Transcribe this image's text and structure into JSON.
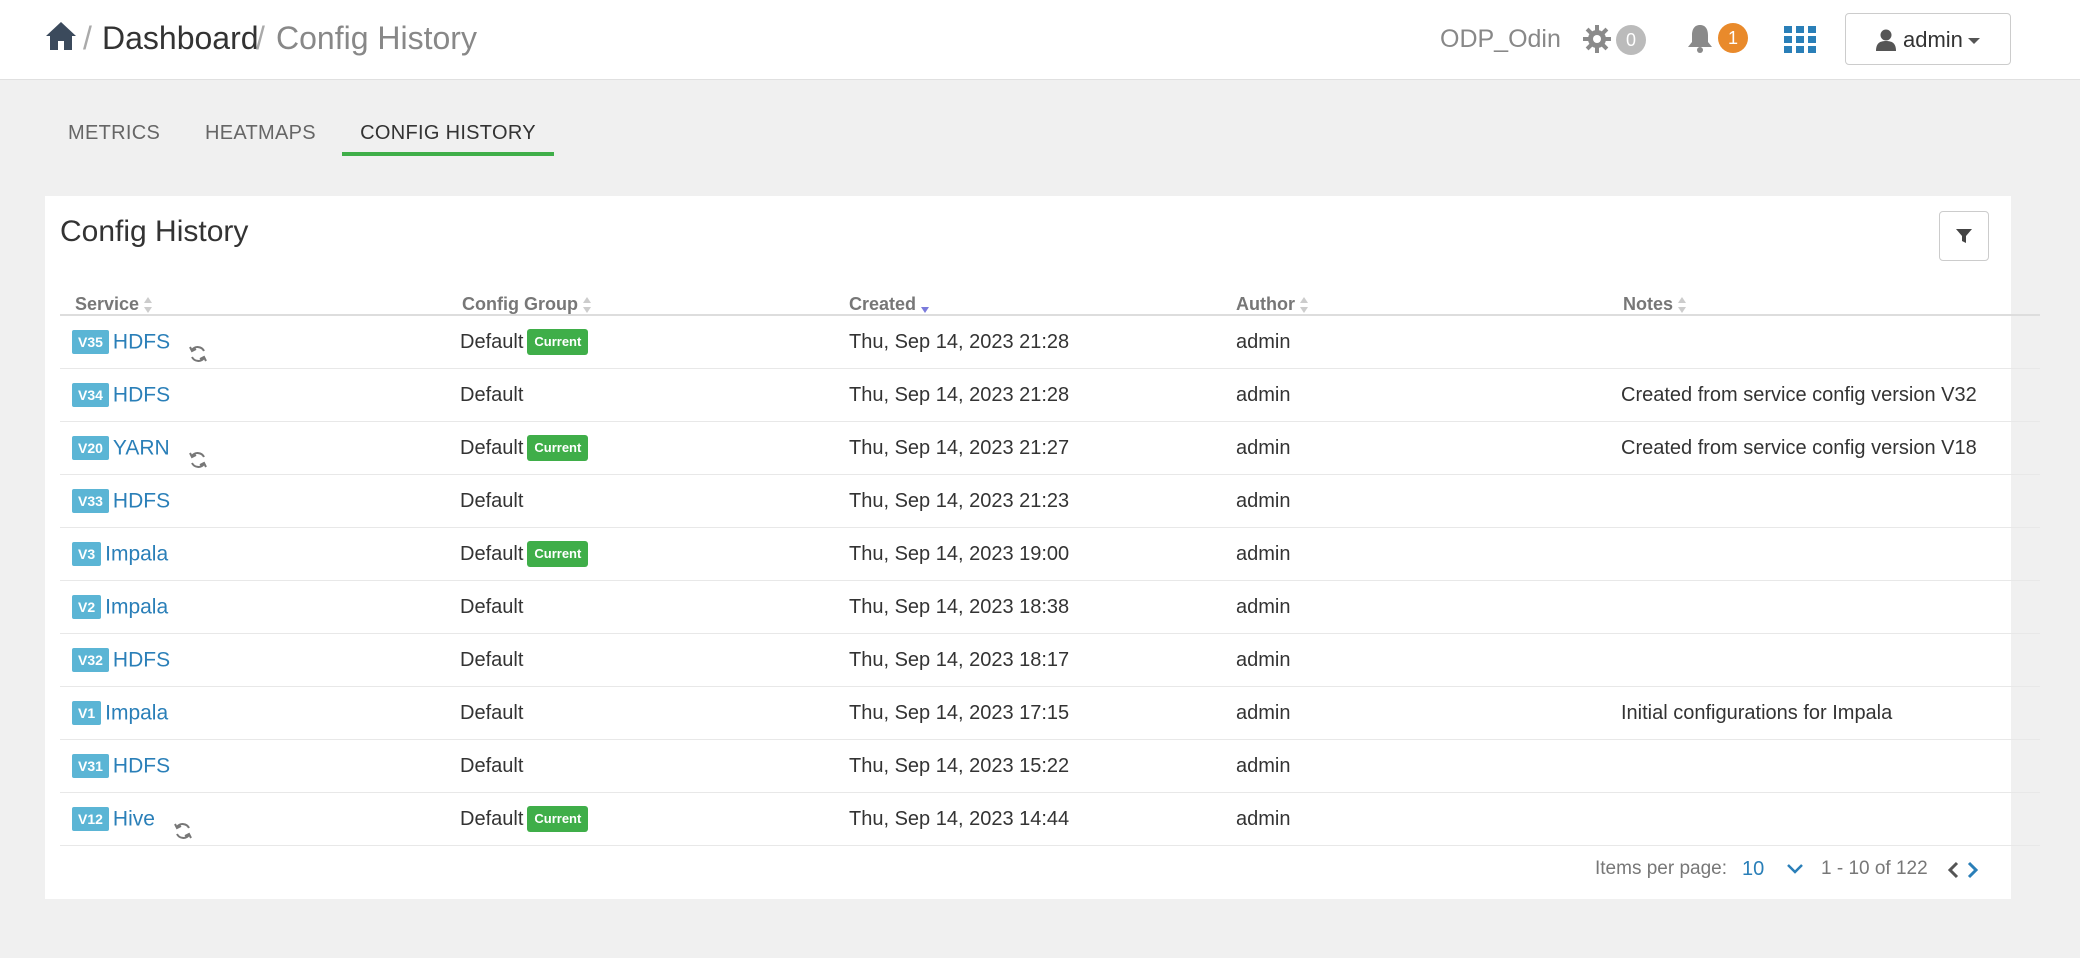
{
  "header": {
    "breadcrumb": {
      "sep1": "/",
      "dashboard": "Dashboard",
      "sep2": "/",
      "current": "Config History"
    },
    "cluster_name": "ODP_Odin",
    "ops_count": "0",
    "alerts_count": "1",
    "user_label": "admin"
  },
  "tabs": [
    {
      "label": "METRICS"
    },
    {
      "label": "HEATMAPS"
    },
    {
      "label": "CONFIG HISTORY"
    }
  ],
  "panel": {
    "title": "Config History",
    "columns": [
      "Service",
      "Config Group",
      "Created",
      "Author",
      "Notes"
    ]
  },
  "rows": [
    {
      "version": "V35",
      "service": "HDFS",
      "refresh": true,
      "group": "Default",
      "current": "Current",
      "created": "Thu, Sep 14, 2023 21:28",
      "author": "admin",
      "notes": ""
    },
    {
      "version": "V34",
      "service": "HDFS",
      "refresh": false,
      "group": "Default",
      "current": "",
      "created": "Thu, Sep 14, 2023 21:28",
      "author": "admin",
      "notes": "Created from service config version V32"
    },
    {
      "version": "V20",
      "service": "YARN",
      "refresh": true,
      "group": "Default",
      "current": "Current",
      "created": "Thu, Sep 14, 2023 21:27",
      "author": "admin",
      "notes": "Created from service config version V18"
    },
    {
      "version": "V33",
      "service": "HDFS",
      "refresh": false,
      "group": "Default",
      "current": "",
      "created": "Thu, Sep 14, 2023 21:23",
      "author": "admin",
      "notes": ""
    },
    {
      "version": "V3",
      "service": "Impala",
      "refresh": false,
      "group": "Default",
      "current": "Current",
      "created": "Thu, Sep 14, 2023 19:00",
      "author": "admin",
      "notes": ""
    },
    {
      "version": "V2",
      "service": "Impala",
      "refresh": false,
      "group": "Default",
      "current": "",
      "created": "Thu, Sep 14, 2023 18:38",
      "author": "admin",
      "notes": ""
    },
    {
      "version": "V32",
      "service": "HDFS",
      "refresh": false,
      "group": "Default",
      "current": "",
      "created": "Thu, Sep 14, 2023 18:17",
      "author": "admin",
      "notes": ""
    },
    {
      "version": "V1",
      "service": "Impala",
      "refresh": false,
      "group": "Default",
      "current": "",
      "created": "Thu, Sep 14, 2023 17:15",
      "author": "admin",
      "notes": "Initial configurations for Impala"
    },
    {
      "version": "V31",
      "service": "HDFS",
      "refresh": false,
      "group": "Default",
      "current": "",
      "created": "Thu, Sep 14, 2023 15:22",
      "author": "admin",
      "notes": ""
    },
    {
      "version": "V12",
      "service": "Hive",
      "refresh": true,
      "group": "Default",
      "current": "Current",
      "created": "Thu, Sep 14, 2023 14:44",
      "author": "admin",
      "notes": ""
    }
  ],
  "pagination": {
    "items_per_page_label": "Items per page:",
    "items_per_page_value": "10",
    "range": "1 - 10 of 122"
  },
  "colors": {
    "accent_green": "#3fae49",
    "link_blue": "#2a7fb8",
    "version_badge": "#5bb5d5",
    "alert_orange": "#e98a2b"
  }
}
